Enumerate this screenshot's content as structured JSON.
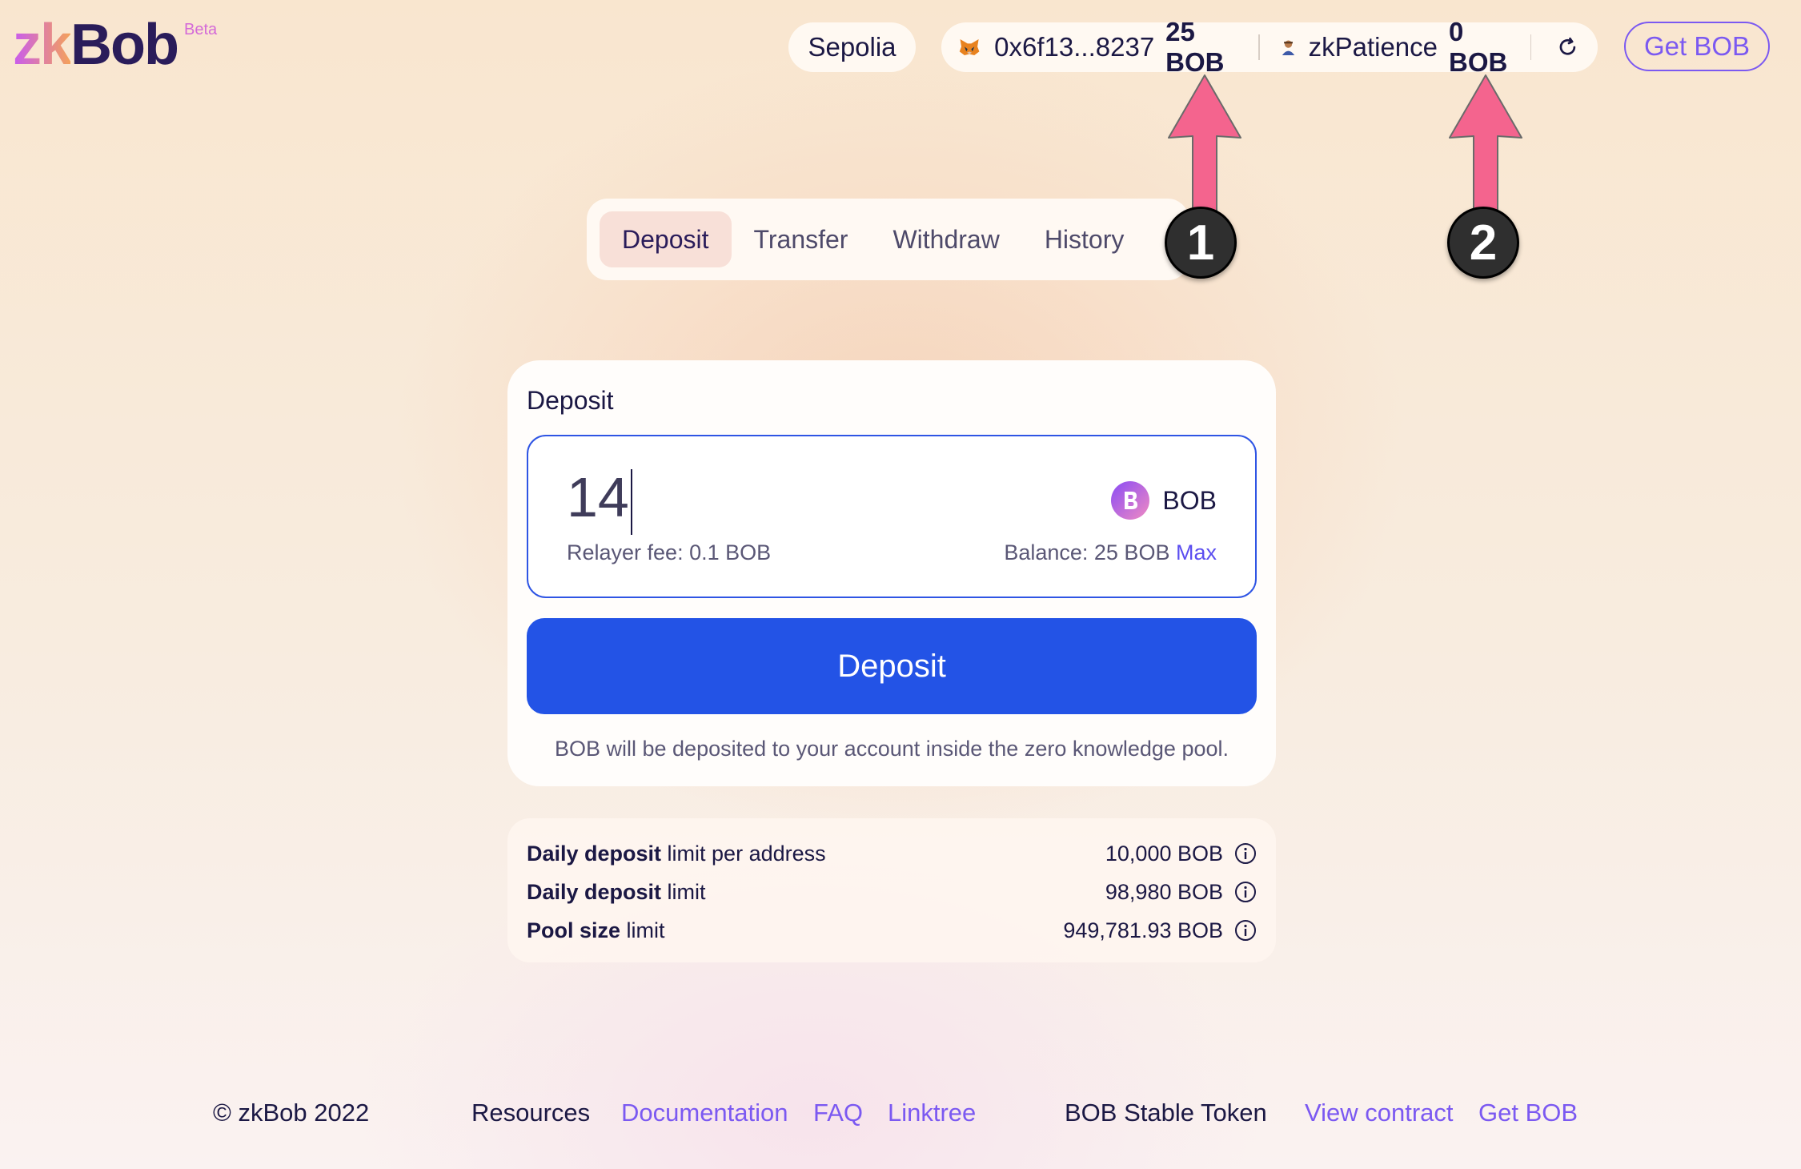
{
  "logo": {
    "zk": "zk",
    "bob": "Bob",
    "beta": "Beta"
  },
  "header": {
    "network": "Sepolia",
    "wallet_address": "0x6f13...8237",
    "wallet_balance": "25 BOB",
    "account_name": "zkPatience",
    "account_balance": "0 BOB",
    "get_bob": "Get BOB"
  },
  "tabs": [
    {
      "label": "Deposit",
      "active": true
    },
    {
      "label": "Transfer",
      "active": false
    },
    {
      "label": "Withdraw",
      "active": false
    },
    {
      "label": "History",
      "active": false
    }
  ],
  "annotations": {
    "badge1": "1",
    "badge2": "2",
    "color": "#f4648e"
  },
  "deposit_card": {
    "title": "Deposit",
    "amount": "14",
    "token": "BOB",
    "relayer_fee": "Relayer fee: 0.1 BOB",
    "balance": "Balance: 25 BOB",
    "max": "Max",
    "button": "Deposit",
    "note": "BOB will be deposited to your account inside the zero knowledge pool."
  },
  "limits": [
    {
      "bold": "Daily deposit",
      "rest": " limit per address",
      "value": "10,000 BOB"
    },
    {
      "bold": "Daily deposit",
      "rest": " limit",
      "value": "98,980 BOB"
    },
    {
      "bold": "Pool size",
      "rest": " limit",
      "value": "949,781.93 BOB"
    }
  ],
  "footer": {
    "copyright": "© zkBob 2022",
    "resources": "Resources",
    "documentation": "Documentation",
    "faq": "FAQ",
    "linktree": "Linktree",
    "stable_token": "BOB Stable Token",
    "view_contract": "View contract",
    "get_bob": "Get BOB"
  },
  "colors": {
    "accent": "#7b59f1",
    "primary_button": "#2353e6",
    "arrow": "#f4648e"
  }
}
